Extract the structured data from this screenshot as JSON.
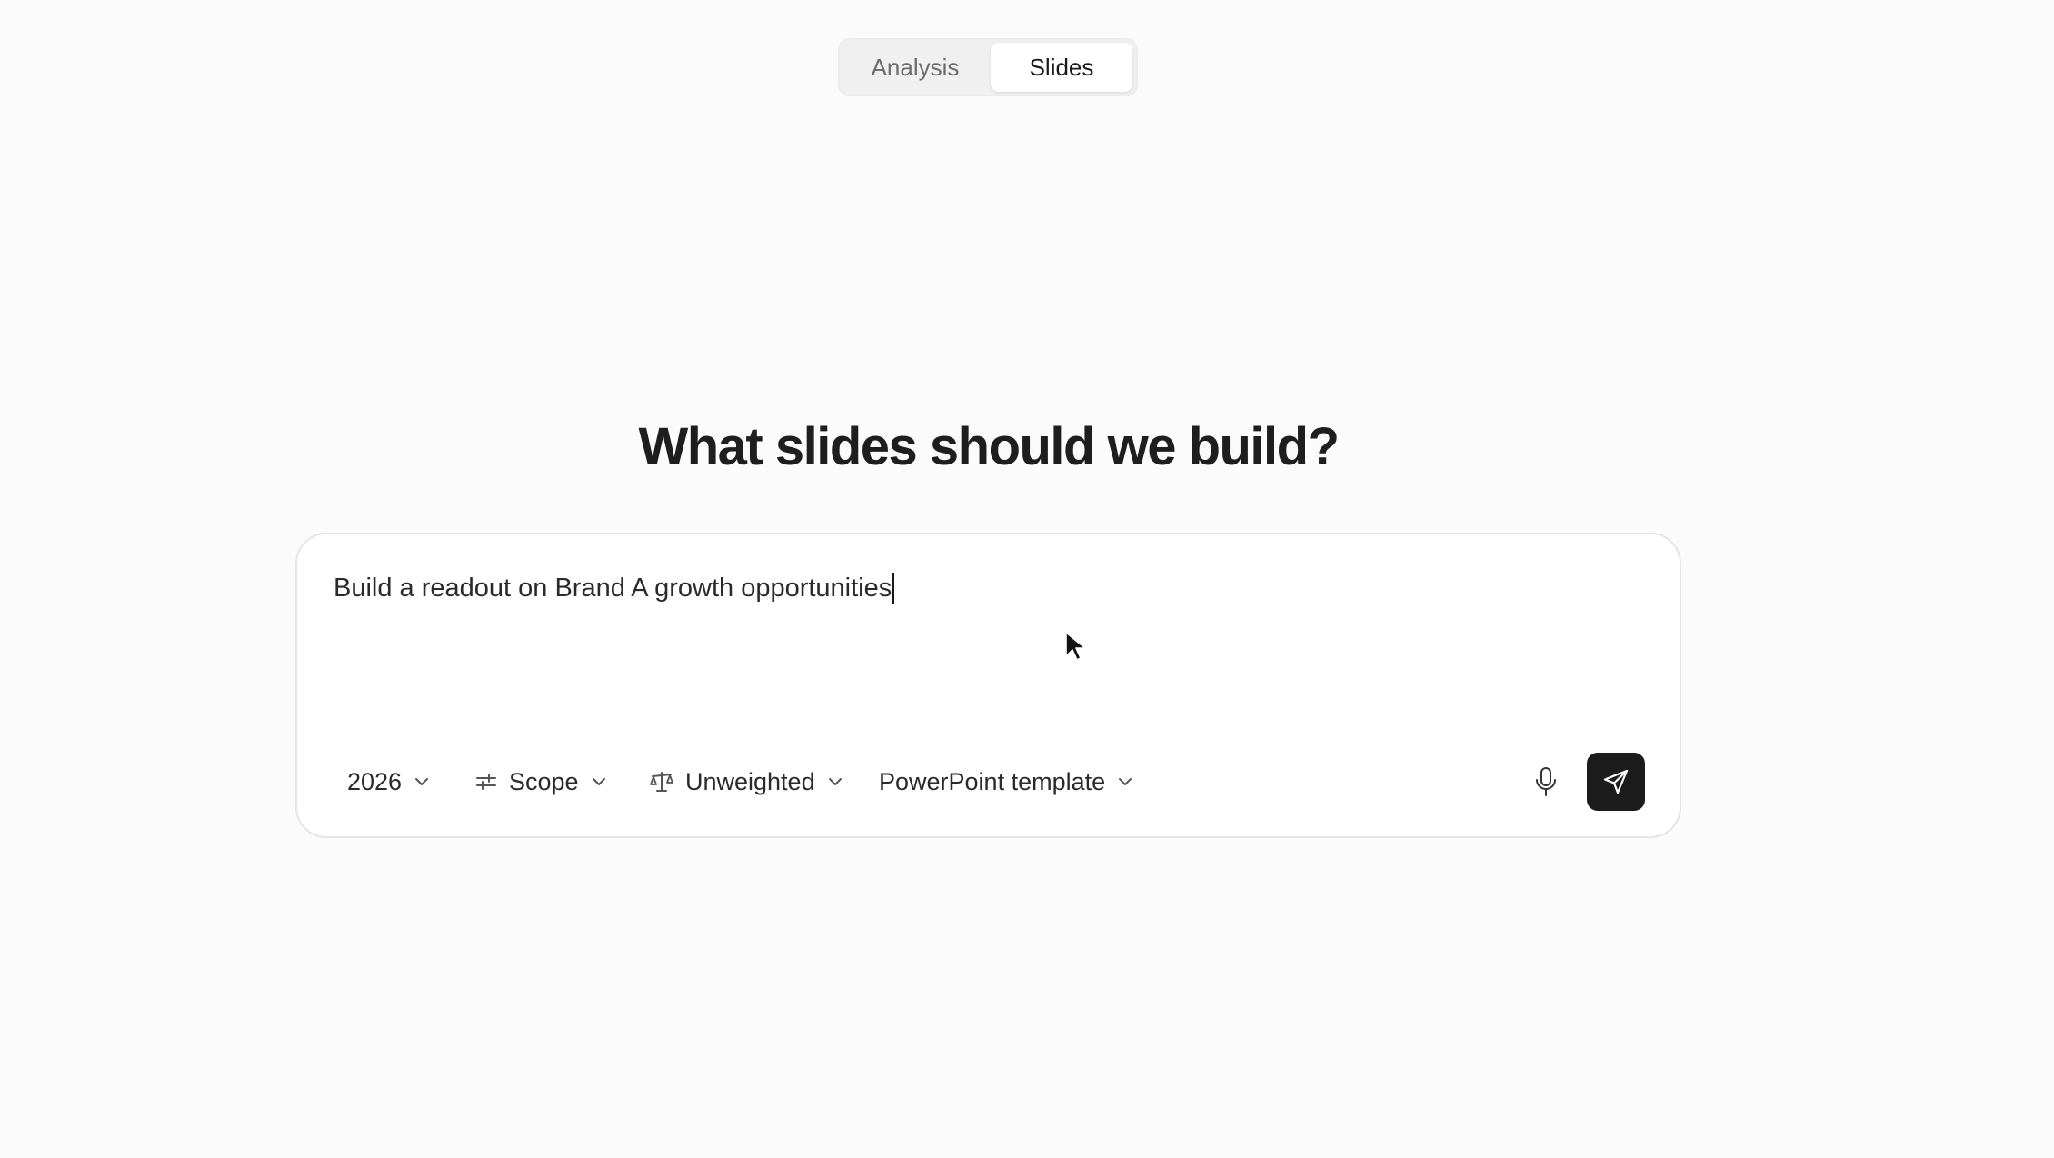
{
  "mode_toggle": {
    "tabs": [
      {
        "label": "Analysis",
        "active": false
      },
      {
        "label": "Slides",
        "active": true
      }
    ]
  },
  "heading": "What slides should we build?",
  "composer": {
    "prompt_value": "Build a readout on Brand A growth opportunities",
    "toolbar": {
      "year": {
        "label": "2026",
        "icon": "chevron-down-icon"
      },
      "scope": {
        "label": "Scope",
        "icon": "sliders-icon"
      },
      "weighting": {
        "label": "Unweighted",
        "icon": "scale-icon"
      },
      "template": {
        "label": "PowerPoint template",
        "icon": "chevron-down-icon"
      }
    },
    "mic_icon": "microphone-icon",
    "send_icon": "send-icon"
  },
  "colors": {
    "background": "#fcfbfb",
    "send_button": "#1c1c1c",
    "toggle_bg": "#f1f0f0"
  }
}
